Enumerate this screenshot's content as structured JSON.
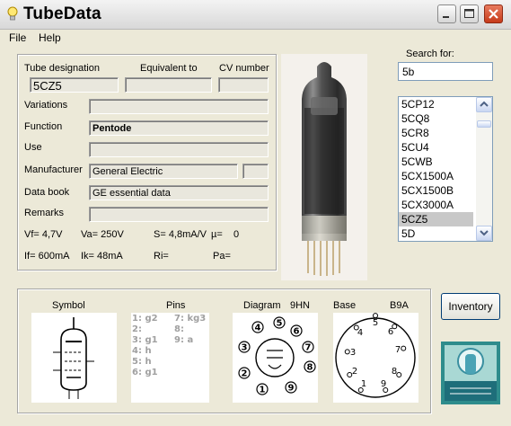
{
  "window": {
    "title": "TubeData",
    "minimize_label": "_",
    "maximize_label": "□",
    "close_label": "✕"
  },
  "menu": {
    "file": "File",
    "help": "Help"
  },
  "header": {
    "designation_label": "Tube designation",
    "equivalent_label": "Equivalent to",
    "cv_label": "CV number",
    "designation_value": "5CZ5",
    "equivalent_value": "",
    "cv_value": ""
  },
  "fields": {
    "variations_label": "Variations",
    "variations_value": "",
    "function_label": "Function",
    "function_value": "Pentode",
    "use_label": "Use",
    "use_value": "",
    "manufacturer_label": "Manufacturer",
    "manufacturer_value": "General Electric",
    "manufacturer_extra": "",
    "databook_label": "Data book",
    "databook_value": "GE essential data",
    "remarks_label": "Remarks",
    "remarks_value": ""
  },
  "specs": {
    "vf": "Vf= 4,7V",
    "va": "Va= 250V",
    "s": "S= 4,8mA/V",
    "mu": "µ=",
    "mu_value": "0",
    "if": "If= 600mA",
    "ik": "Ik= 48mA",
    "ri": "Ri=",
    "pa": "Pa="
  },
  "search": {
    "label": "Search for:",
    "value": "5b"
  },
  "results": [
    "5CP12",
    "5CQ8",
    "5CR8",
    "5CU4",
    "5CWB",
    "5CX1500A",
    "5CX1500B",
    "5CX3000A",
    "5CZ5",
    "5D"
  ],
  "results_selected": "5CZ5",
  "bottom": {
    "symbol_label": "Symbol",
    "pins_label": "Pins",
    "diagram_label": "Diagram",
    "diagram_code": "9HN",
    "base_label": "Base",
    "base_code": "B9A",
    "pins_col1": [
      "1: g2",
      "2:",
      "3: g1",
      "4: h",
      "5: h",
      "6: g1"
    ],
    "pins_col2": [
      "7: kg3",
      "8:",
      "9: a"
    ],
    "diagram_pins": [
      "1",
      "2",
      "3",
      "4",
      "5",
      "6",
      "7",
      "8",
      "9"
    ],
    "base_pins": [
      "1",
      "2",
      "3",
      "4",
      "5",
      "6",
      "7",
      "8",
      "9"
    ],
    "inventory_label": "Inventory"
  },
  "icons": {
    "app": "lightbulb-icon",
    "scroll_up": "chevron-up-icon",
    "scroll_down": "chevron-down-icon"
  },
  "colors": {
    "close_button": "#D5492A",
    "selection": "#C8C8C8"
  }
}
